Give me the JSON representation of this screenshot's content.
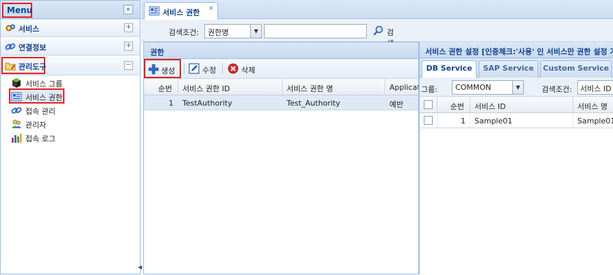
{
  "sidebar": {
    "title": "Menu",
    "collapse_icon": "«",
    "sections": [
      {
        "label": "서비스",
        "toggle": "+"
      },
      {
        "label": "연결정보",
        "toggle": "+"
      },
      {
        "label": "관리도구",
        "toggle": "−"
      }
    ],
    "items": [
      {
        "label": "서비스 그룹"
      },
      {
        "label": "서비스 권한"
      },
      {
        "label": "접속 관리"
      },
      {
        "label": "관리자"
      },
      {
        "label": "접속 로그"
      }
    ]
  },
  "main": {
    "tab": {
      "label": "서비스 권한",
      "close": "✕"
    },
    "search": {
      "label": "검색조건:",
      "selected": "권한명",
      "input_value": "",
      "button_label": "검색"
    },
    "auth_panel": {
      "title": "권한",
      "toolbar": {
        "create": "생성",
        "edit": "수정",
        "delete": "삭제"
      },
      "columns": [
        "순번",
        "서비스 권한 ID",
        "서비스 권한 명",
        "Application"
      ],
      "rows": [
        {
          "no": "1",
          "id": "TestAuthority",
          "name": "Test_Authority",
          "app": "예반"
        }
      ]
    },
    "svc_panel": {
      "title": "서비스 권한 설정 [인증체크:'사용' 인 서비스만 권한 설정 가능]",
      "tabs": [
        "DB Service",
        "SAP Service",
        "Custom Service"
      ],
      "group_label": "그룹:",
      "group_selected": "COMMON",
      "search_label": "검색조건:",
      "search_selected": "서비스 ID",
      "columns": [
        "순번",
        "서비스 ID",
        "서비스 명"
      ],
      "rows": [
        {
          "no": "1",
          "id": "Sample01",
          "name": "Sample01"
        }
      ]
    }
  },
  "colors": {
    "header_blue": "#15428b",
    "highlight_red": "#e02020",
    "border_blue": "#99bbe8"
  }
}
